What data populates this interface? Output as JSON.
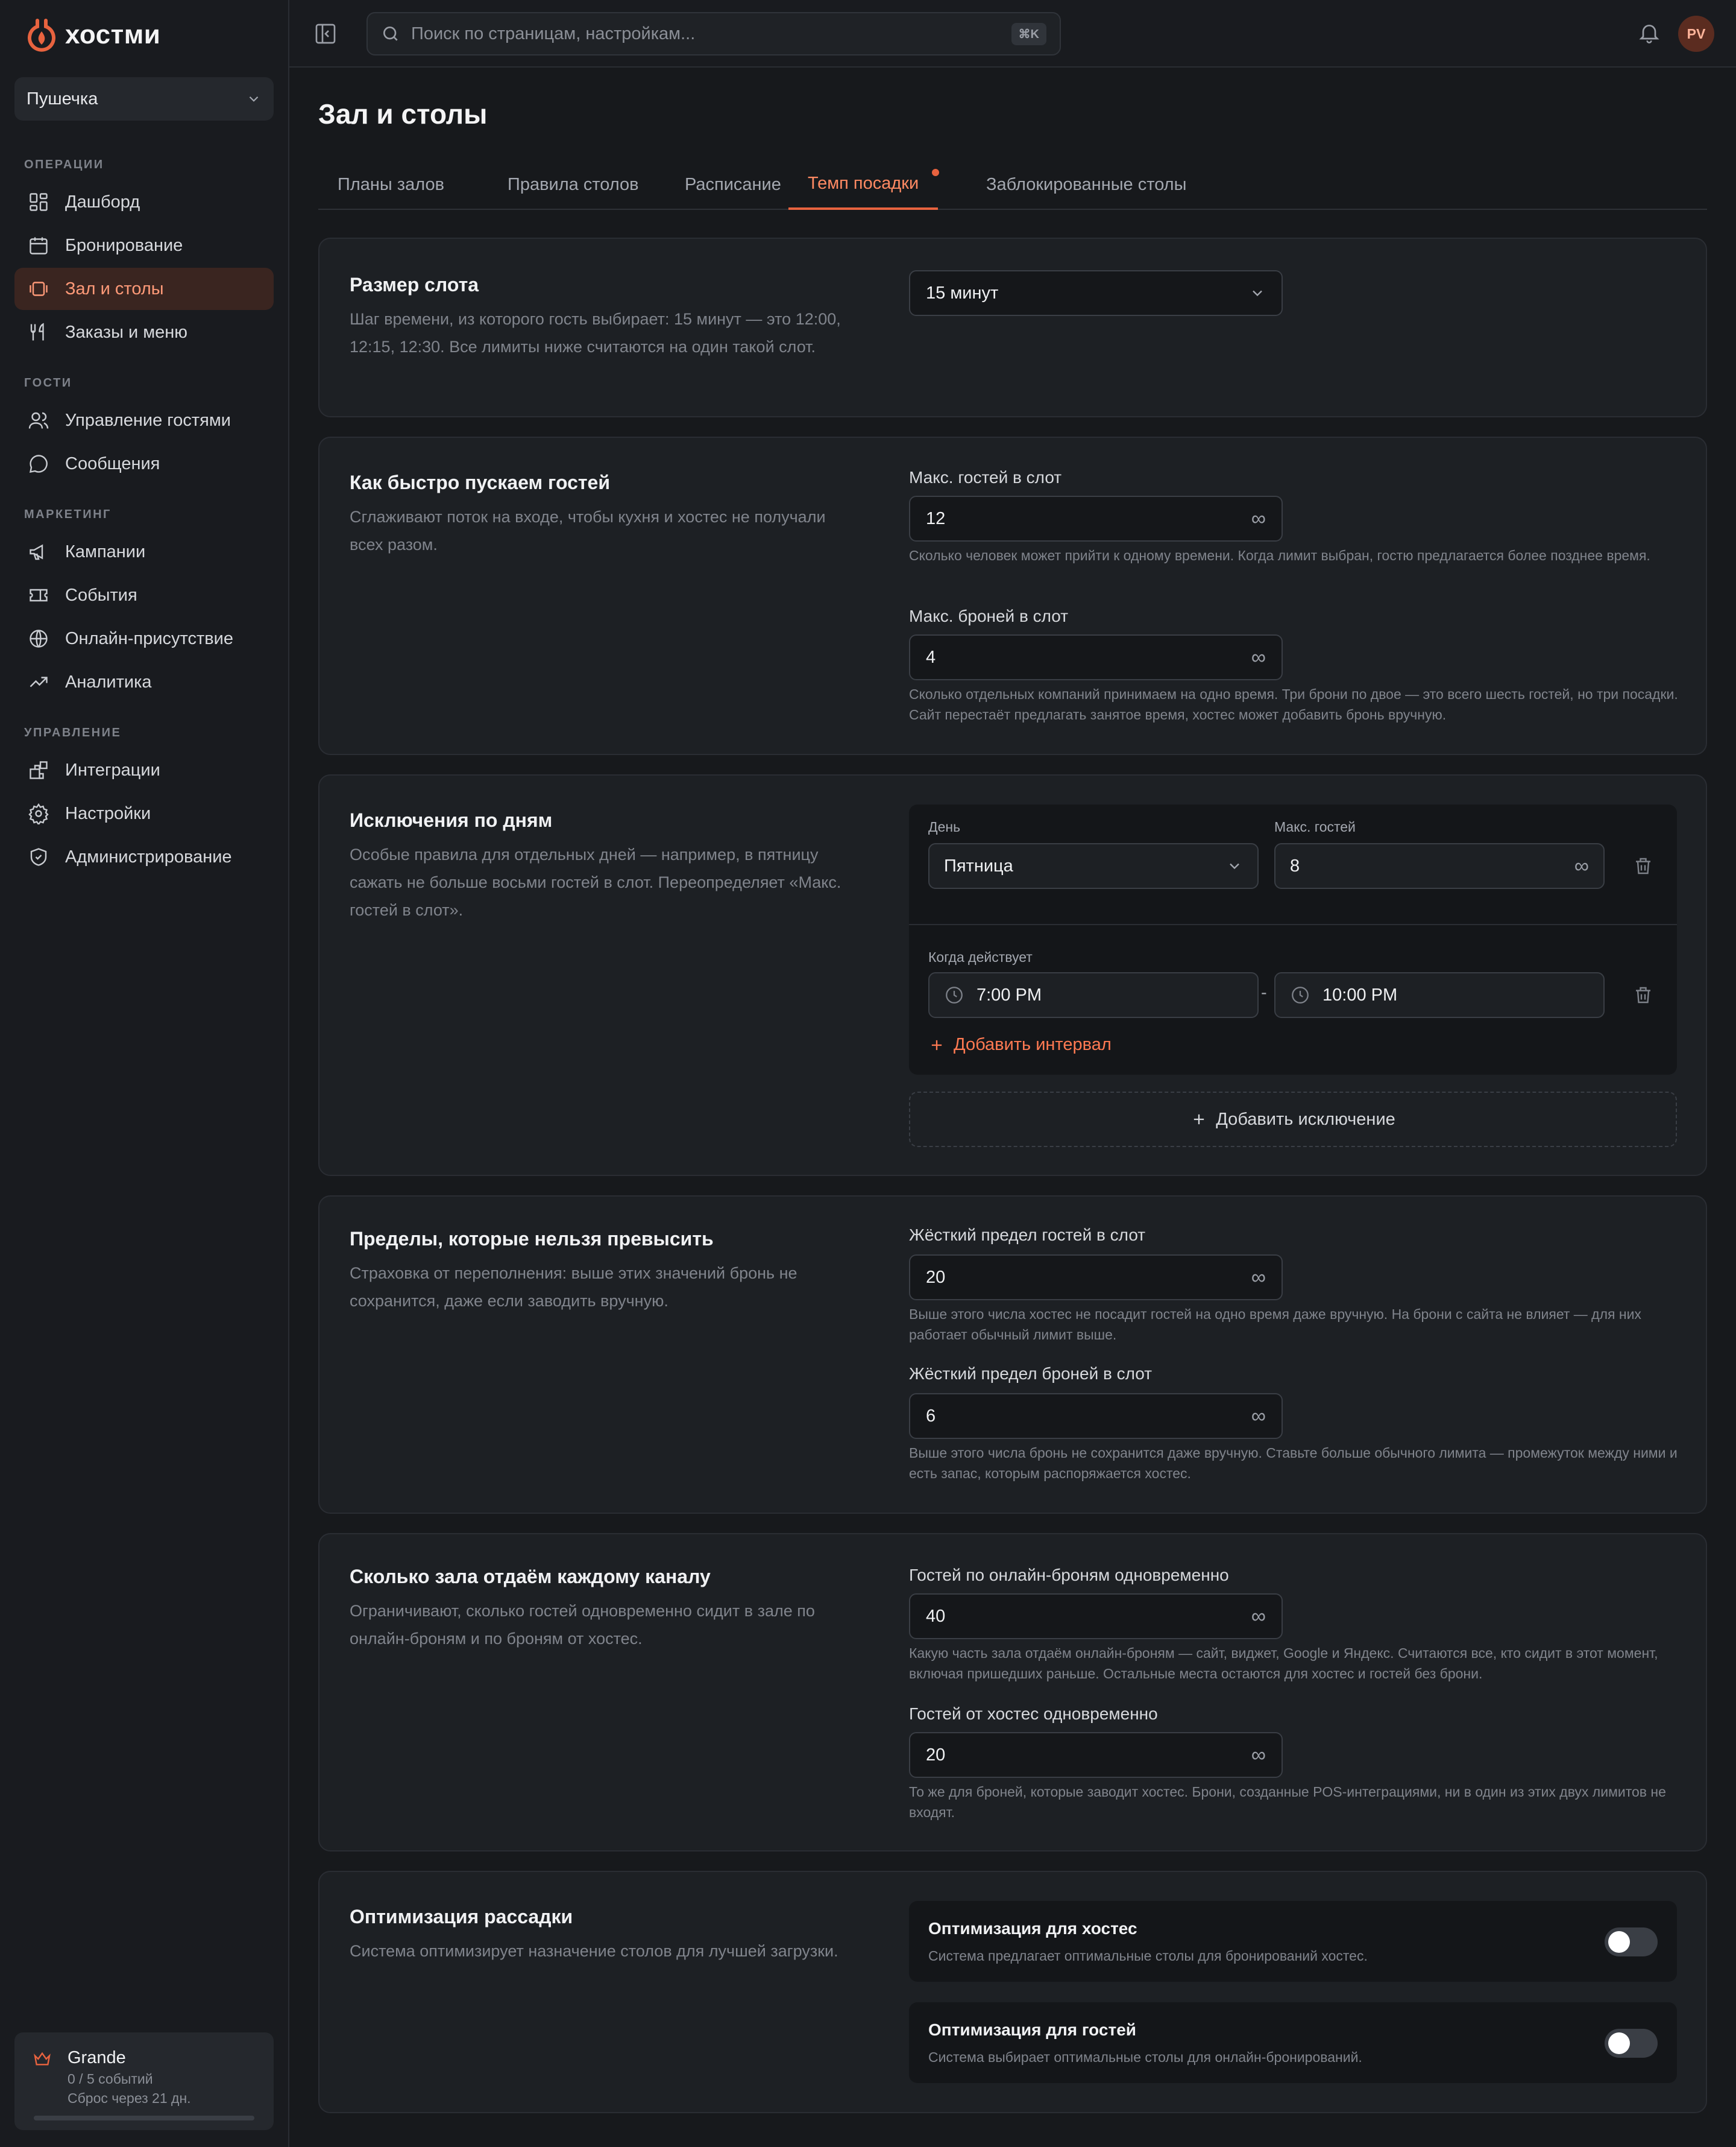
{
  "app": {
    "brand": "хостми",
    "venue": "Пушечка"
  },
  "search": {
    "placeholder": "Поиск по страницам, настройкам...",
    "shortcut": "⌘K"
  },
  "user": {
    "initials": "PV"
  },
  "nav": {
    "sections": [
      "Операции",
      "Гости",
      "Маркетинг",
      "Управление"
    ],
    "items": [
      {
        "label": "Дашборд",
        "icon": "dashboard-icon"
      },
      {
        "label": "Бронирование",
        "icon": "calendar-icon"
      },
      {
        "label": "Зал и столы",
        "icon": "tables-icon",
        "active": true
      },
      {
        "label": "Заказы и меню",
        "icon": "utensils-icon"
      },
      {
        "label": "Управление гостями",
        "icon": "users-icon"
      },
      {
        "label": "Сообщения",
        "icon": "chat-icon"
      },
      {
        "label": "Кампании",
        "icon": "megaphone-icon"
      },
      {
        "label": "События",
        "icon": "ticket-icon"
      },
      {
        "label": "Онлайн-присутствие",
        "icon": "globe-icon"
      },
      {
        "label": "Аналитика",
        "icon": "trend-icon"
      },
      {
        "label": "Интеграции",
        "icon": "blocks-icon"
      },
      {
        "label": "Настройки",
        "icon": "gear-icon"
      },
      {
        "label": "Администрирование",
        "icon": "shield-icon"
      }
    ]
  },
  "plan": {
    "name": "Grande",
    "usage": "0 / 5 событий",
    "reset": "Сброс через 21 дн.",
    "usage_fraction": 0
  },
  "page": {
    "title": "Зал и столы",
    "tabs": [
      "Планы залов",
      "Правила столов",
      "Расписание",
      "Темп посадки",
      "Заблокированные столы"
    ],
    "active_tab": "Темп посадки"
  },
  "slot": {
    "title": "Размер слота",
    "desc": "Шаг времени, из которого гость выбирает: 15 минут — это 12:00, 12:15, 12:30. Все лимиты ниже считаются на один такой слот.",
    "value": "15 минут"
  },
  "pace": {
    "title": "Как быстро пускаем гостей",
    "desc": "Сглаживают поток на входе, чтобы кухня и хостес не получали всех разом.",
    "guests_label": "Макс. гостей в слот",
    "guests_value": "12",
    "guests_help": "Сколько человек может прийти к одному времени. Когда лимит выбран, гостю предлагается более позднее время.",
    "bookings_label": "Макс. броней в слот",
    "bookings_value": "4",
    "bookings_help": "Сколько отдельных компаний принимаем на одно время. Три брони по двое — это всего шесть гостей, но три посадки. Сайт перестаёт предлагать занятое время, хостес может добавить бронь вручную."
  },
  "exceptions": {
    "title": "Исключения по дням",
    "desc": "Особые правила для отдельных дней — например, в пятницу сажать не больше восьми гостей в слот. Переопределяет «Макс. гостей в слот».",
    "day_label": "День",
    "day_value": "Пятница",
    "max_label": "Макс. гостей",
    "max_value": "8",
    "when_label": "Когда действует",
    "from": "7:00 PM",
    "separator": "-",
    "to": "10:00 PM",
    "add_interval": "Добавить интервал",
    "add_exception": "Добавить исключение"
  },
  "hard": {
    "title": "Пределы, которые нельзя превысить",
    "desc": "Страховка от переполнения: выше этих значений бронь не сохранится, даже если заводить вручную.",
    "guests_label": "Жёсткий предел гостей в слот",
    "guests_value": "20",
    "guests_help": "Выше этого числа хостес не посадит гостей на одно время даже вручную. На брони с сайта не влияет — для них работает обычный лимит выше.",
    "bookings_label": "Жёсткий предел броней в слот",
    "bookings_value": "6",
    "bookings_help": "Выше этого числа бронь не сохранится даже вручную. Ставьте больше обычного лимита — промежуток между ними и есть запас, которым распоряжается хостес."
  },
  "channels": {
    "title": "Сколько зала отдаём каждому каналу",
    "desc": "Ограничивают, сколько гостей одновременно сидит в зале по онлайн-броням и по броням от хостес.",
    "online_label": "Гостей по онлайн-броням одновременно",
    "online_value": "40",
    "online_help": "Какую часть зала отдаём онлайн-броням — сайт, виджет, Google и Яндекс. Считаются все, кто сидит в этот момент, включая пришедших раньше. Остальные места остаются для хостес и гостей без брони.",
    "host_label": "Гостей от хостес одновременно",
    "host_value": "20",
    "host_help": "То же для броней, которые заводит хостес. Брони, созданные POS-интеграциями, ни в один из этих двух лимитов не входят."
  },
  "optimization": {
    "title": "Оптимизация рассадки",
    "desc": "Система оптимизирует назначение столов для лучшей загрузки.",
    "host_title": "Оптимизация для хостес",
    "host_desc": "Система предлагает оптимальные столы для бронирований хостес.",
    "host_enabled": false,
    "guest_title": "Оптимизация для гостей",
    "guest_desc": "Система выбирает оптимальные столы для онлайн-бронирований.",
    "guest_enabled": false
  },
  "symbols": {
    "infinity": "∞"
  },
  "colors": {
    "accent": "#e8633f",
    "background": "#17191c",
    "card": "#1d2024"
  }
}
